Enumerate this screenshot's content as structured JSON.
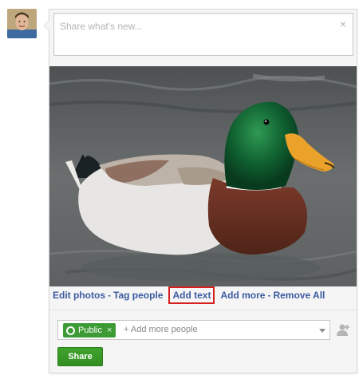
{
  "composer": {
    "placeholder": "Share what's new...",
    "close_glyph": "×"
  },
  "photo": {
    "description_icon": "mallard-duck-photo"
  },
  "photo_actions": {
    "edit_photos": "Edit photos",
    "tag_people": "Tag people",
    "add_text": "Add text",
    "add_more": "Add more",
    "remove_all": "Remove All",
    "separator": "-"
  },
  "audience": {
    "chip_label": "Public",
    "chip_remove": "×",
    "add_more_people": "+ Add more people"
  },
  "share_button": "Share",
  "colors": {
    "link": "#3b5ba0",
    "highlight_box": "#d62020",
    "public_chip": "#3d9b35",
    "share_button": "#3a9a28"
  }
}
